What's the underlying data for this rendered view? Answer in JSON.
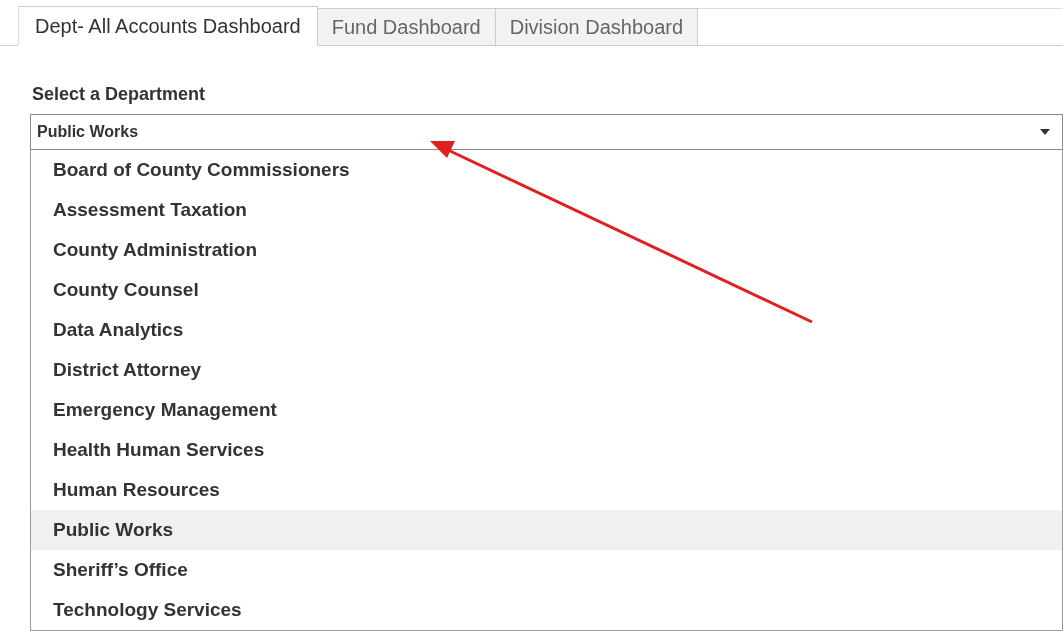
{
  "tabs": [
    {
      "label": "Dept- All Accounts Dashboard",
      "selected": true
    },
    {
      "label": "Fund Dashboard",
      "selected": false
    },
    {
      "label": "Division Dashboard",
      "selected": false
    }
  ],
  "filter": {
    "label": "Select a Department",
    "value": "Public Works",
    "expanded": true,
    "options": [
      {
        "label": "Board of County Commissioners",
        "selected": false
      },
      {
        "label": "Assessment Taxation",
        "selected": false
      },
      {
        "label": "County Administration",
        "selected": false
      },
      {
        "label": "County Counsel",
        "selected": false
      },
      {
        "label": "Data Analytics",
        "selected": false
      },
      {
        "label": "District Attorney",
        "selected": false
      },
      {
        "label": "Emergency Management",
        "selected": false
      },
      {
        "label": "Health Human Services",
        "selected": false
      },
      {
        "label": "Human Resources",
        "selected": false
      },
      {
        "label": "Public Works",
        "selected": true
      },
      {
        "label": "Sheriff’s Office",
        "selected": false
      },
      {
        "label": "Technology Services",
        "selected": false
      }
    ]
  }
}
